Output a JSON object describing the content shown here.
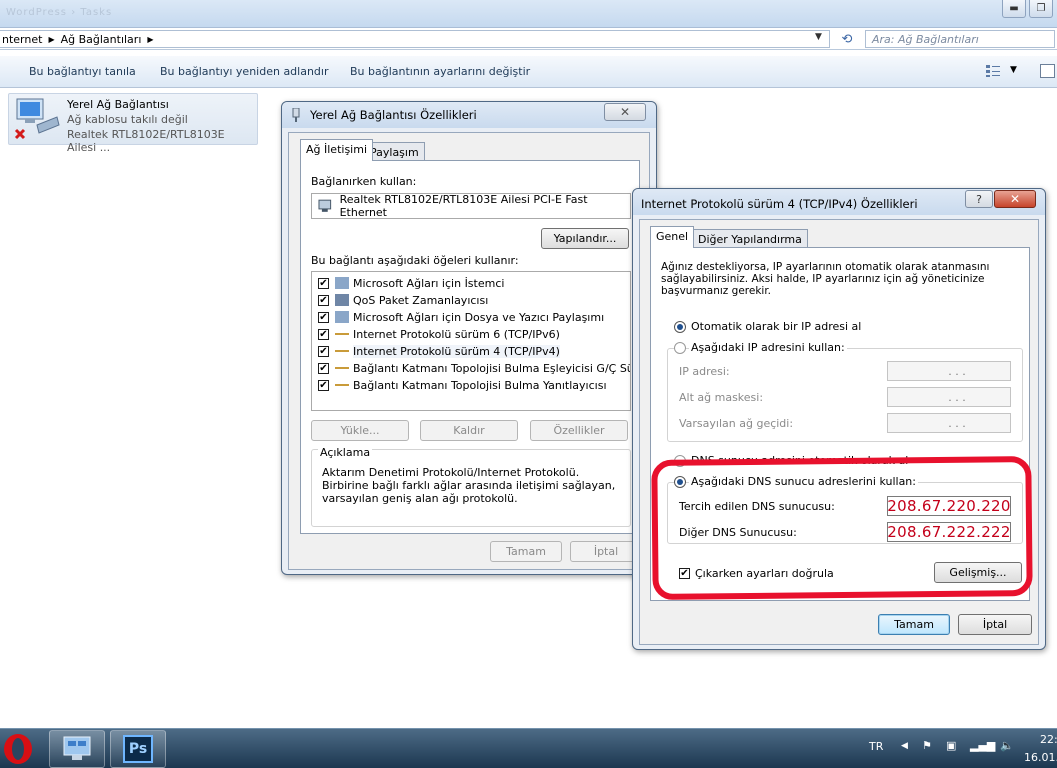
{
  "explorer": {
    "window_title_ghost": "WordPress › Tasks",
    "breadcrumb": [
      "nternet",
      "Ağ Bağlantıları"
    ],
    "search_placeholder": "Ara: Ağ Bağlantıları",
    "commands": [
      "Bu bağlantıyı tanıla",
      "Bu bağlantıyı yeniden adlandır",
      "Bu bağlantının ayarlarını değiştir"
    ],
    "connection": {
      "name": "Yerel Ağ Bağlantısı",
      "status": "Ağ kablosu takılı değil",
      "adapter": "Realtek RTL8102E/RTL8103E Ailesi ..."
    }
  },
  "lan_dialog": {
    "title": "Yerel Ağ Bağlantısı Özellikleri",
    "close": "✕",
    "tabs": [
      "Ağ İletişimi",
      "Paylaşım"
    ],
    "connect_using_label": "Bağlanırken kullan:",
    "adapter_name": "Realtek RTL8102E/RTL8103E Ailesi PCI-E Fast Ethernet",
    "configure_button": "Yapılandır...",
    "items_label": "Bu bağlantı aşağıdaki öğeleri kullanır:",
    "items": [
      "Microsoft Ağları için İstemci",
      "QoS Paket Zamanlayıcısı",
      "Microsoft Ağları için Dosya ve Yazıcı Paylaşımı",
      "Internet Protokolü sürüm 6 (TCP/IPv6)",
      "Internet Protokolü sürüm 4 (TCP/IPv4)",
      "Bağlantı Katmanı Topolojisi Bulma Eşleyicisi G/Ç Sürücü...",
      "Bağlantı Katmanı Topolojisi Bulma Yanıtlayıcısı"
    ],
    "install_button": "Yükle...",
    "uninstall_button": "Kaldır",
    "properties_button": "Özellikler",
    "description_title": "Açıklama",
    "description_text": "Aktarım Denetimi Protokolü/Internet Protokolü. Birbirine bağlı farklı ağlar arasında iletişimi sağlayan, varsayılan geniş alan ağı protokolü.",
    "ok_button": "Tamam",
    "cancel_button": "İptal"
  },
  "ipv4_dialog": {
    "title": "Internet Protokolü sürüm 4 (TCP/IPv4) Özellikleri",
    "help": "?",
    "close": "✕",
    "tabs": [
      "Genel",
      "Diğer Yapılandırma"
    ],
    "intro": "Ağınız destekliyorsa, IP ayarlarının otomatik olarak atanmasını sağlayabilirsiniz. Aksi halde, IP ayarlarınız için ağ yöneticinize başvurmanız gerekir.",
    "auto_ip": "Otomatik olarak bir IP adresi al",
    "manual_ip": "Aşağıdaki IP adresini kullan:",
    "ip_label": "IP adresi:",
    "mask_label": "Alt ağ maskesi:",
    "gateway_label": "Varsayılan ağ geçidi:",
    "ip_dots": ". . .",
    "auto_dns": "DNS sunucu adresini otomatik olarak al",
    "manual_dns": "Aşağıdaki DNS sunucu adreslerini kullan:",
    "preferred_dns_label": "Tercih edilen DNS sunucusu:",
    "preferred_dns": "208.67.220.220",
    "alternate_dns_label": "Diğer DNS Sunucusu:",
    "alternate_dns": "208.67.222.222",
    "validate_label": "Çıkarken ayarları doğrula",
    "advanced_button": "Gelişmiş...",
    "ok_button": "Tamam",
    "cancel_button": "İptal"
  },
  "taskbar": {
    "apps": [
      "opera-icon",
      "network-icon",
      "photoshop-icon"
    ],
    "ps_label": "Ps",
    "lang": "TR",
    "clock_time": "22:",
    "clock_date": "16.01."
  },
  "colors": {
    "highlight": "#e8112d",
    "dns_text": "#c4001a"
  }
}
